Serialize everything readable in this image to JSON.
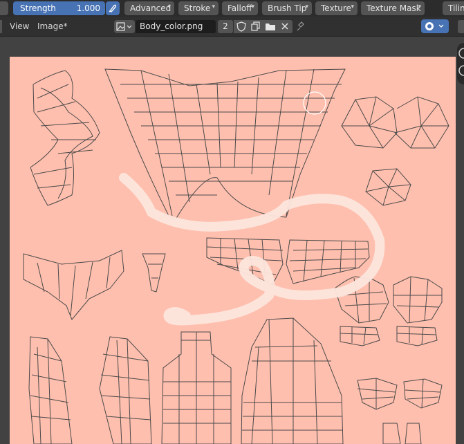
{
  "toolbar": {
    "strength_label": "Strength",
    "strength_value": "1.000",
    "menus": [
      "Advanced",
      "Stroke",
      "Falloff",
      "Brush Tip",
      "Texture",
      "Texture Mask",
      "Tilin"
    ]
  },
  "header": {
    "view": "View",
    "image": "Image*",
    "image_name": "Body_color.png",
    "users": "2"
  },
  "colors": {
    "accent": "#4772b3",
    "canvas": "#ffbfae",
    "stroke": "#fde6dd"
  },
  "icons": [
    "brush-icon",
    "pressure-icon",
    "image-browse-icon",
    "shield-icon",
    "duplicate-icon",
    "folder-icon",
    "close-icon",
    "pin-icon",
    "gizmo-icon"
  ]
}
